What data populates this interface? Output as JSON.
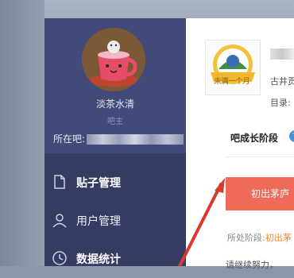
{
  "profile": {
    "name": "淡茶水清",
    "role": "吧主",
    "location_label": "所在吧:"
  },
  "menu": [
    {
      "label": "贴子管理",
      "icon": "document-icon"
    },
    {
      "label": "用户管理",
      "icon": "user-icon"
    },
    {
      "label": "数据统计",
      "icon": "clock-icon"
    }
  ],
  "panel": {
    "badge_text": "未满一个月",
    "line1": "古井贡",
    "line2": "目录:",
    "stage_title": "吧成长阶段",
    "stage_button": "初出茅庐",
    "current_stage_label": "所处阶段:",
    "current_stage_value": "初出茅",
    "bottom_text": "请继续努力，"
  },
  "colors": {
    "sidebar": "#353b63",
    "profile_bg": "#414a78",
    "stage_button": "#ef6a59",
    "arrow": "#d93a2e"
  }
}
